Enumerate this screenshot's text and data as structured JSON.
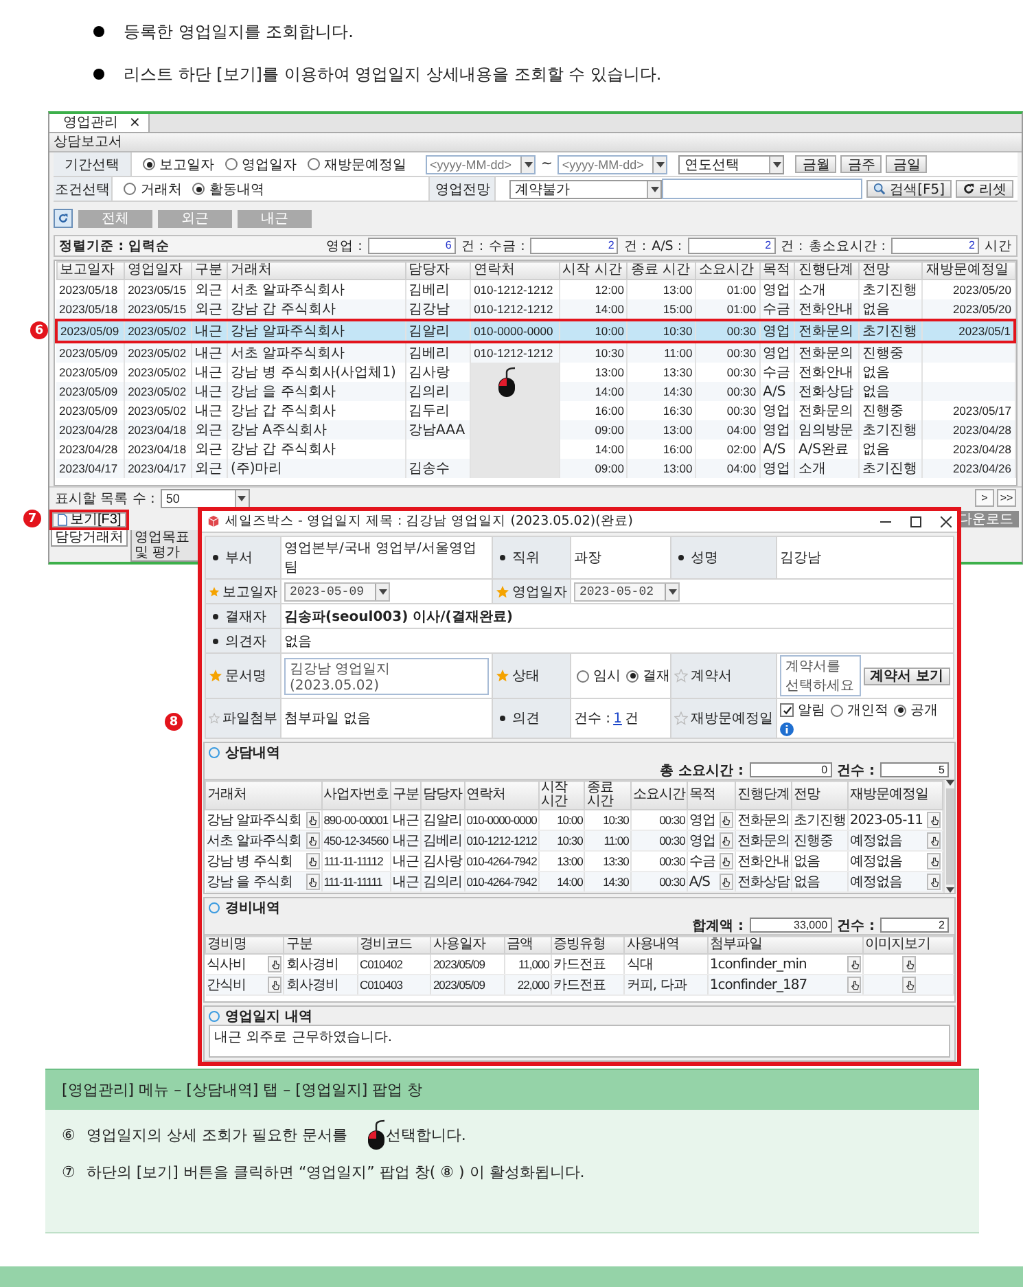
{
  "intro": [
    "등록한 영업일지를 조회합니다.",
    "리스트 하단 [보기]를 이용하여 영업일지 상세내용을 조회할 수 있습니다."
  ],
  "app": {
    "tabs": [
      {
        "label": "영업관리",
        "close": "×",
        "selected": true
      }
    ],
    "title": "상담보고서",
    "period": {
      "label": "기간선택",
      "options": [
        {
          "label": "보고일자",
          "selected": true
        },
        {
          "label": "영업일자",
          "selected": false
        },
        {
          "label": "재방문예정일",
          "selected": false
        }
      ],
      "from": {
        "placeholder": "<yyyy-MM-dd>"
      },
      "separator": "~",
      "to": {
        "placeholder": "<yyyy-MM-dd>"
      },
      "year": "연도선택",
      "quick": [
        "금월",
        "금주",
        "금일"
      ]
    },
    "condition": {
      "label": "조건선택",
      "options": [
        {
          "label": "거래처",
          "selected": false
        },
        {
          "label": "활동내역",
          "selected": true
        }
      ],
      "outlook_label": "영업전망",
      "outlook": "계약불가",
      "search_button": "검색[F5]",
      "reset_button": "리셋"
    },
    "filters": [
      "전체",
      "외근",
      "내근"
    ],
    "summary": {
      "sort": "정렬기준 : 입력순",
      "counts": [
        {
          "label": "영업 :",
          "value": "6",
          "unit": "건 :"
        },
        {
          "label": "수금 :",
          "value": "2",
          "unit": "건 :"
        },
        {
          "label": "A/S :",
          "value": "2",
          "unit": "건 :"
        },
        {
          "label": "총소요시간 :",
          "value": "2",
          "unit": "시간"
        }
      ]
    },
    "table": {
      "columns": [
        {
          "label": "보고일자",
          "kind": "code"
        },
        {
          "label": "영업일자",
          "kind": "code"
        },
        {
          "label": "구분",
          "kind": "text"
        },
        {
          "label": "거래처",
          "kind": "text"
        },
        {
          "label": "담당자",
          "kind": "text"
        },
        {
          "label": "연락처",
          "kind": "code"
        },
        {
          "label": "시작 시간",
          "kind": "num"
        },
        {
          "label": "종료 시간",
          "kind": "num"
        },
        {
          "label": "소요시간",
          "kind": "num"
        },
        {
          "label": "목적",
          "kind": "text"
        },
        {
          "label": "진행단계",
          "kind": "text"
        },
        {
          "label": "전망",
          "kind": "text"
        },
        {
          "label": "재방문예정일",
          "kind": "num"
        }
      ],
      "rows": [
        {
          "selected": false,
          "masked": false,
          "report_date": "2023/05/18",
          "work_date": "2023/05/15",
          "type": "외근",
          "client": "서초 알파주식회사",
          "staff": "김베리",
          "contact": "010-1212-1212",
          "start": "12:00",
          "end": "13:00",
          "duration": "01:00",
          "purpose": "영업",
          "stage": "소개",
          "outlook": "초기진행",
          "revisit": "2023/05/20"
        },
        {
          "selected": false,
          "masked": false,
          "report_date": "2023/05/18",
          "work_date": "2023/05/15",
          "type": "외근",
          "client": "강남 갑 주식회사",
          "staff": "김강남",
          "contact": "010-1212-1212",
          "start": "14:00",
          "end": "15:00",
          "duration": "01:00",
          "purpose": "수금",
          "stage": "전화안내",
          "outlook": "없음",
          "revisit": "2023/05/20"
        },
        {
          "selected": true,
          "masked": false,
          "callout": "6",
          "report_date": "2023/05/09",
          "work_date": "2023/05/02",
          "type": "내근",
          "client": "강남 알파주식회사",
          "staff": "김알리",
          "contact": "010-0000-0000",
          "start": "10:00",
          "end": "10:30",
          "duration": "00:30",
          "purpose": "영업",
          "stage": "전화문의",
          "outlook": "초기진행",
          "revisit": "2023/05/1"
        },
        {
          "selected": false,
          "masked": false,
          "report_date": "2023/05/09",
          "work_date": "2023/05/02",
          "type": "내근",
          "client": "서초 알파주식회사",
          "staff": "김베리",
          "contact": "010-1212-1212",
          "start": "10:30",
          "end": "11:00",
          "duration": "00:30",
          "purpose": "영업",
          "stage": "전화문의",
          "outlook": "진행중"
        },
        {
          "selected": false,
          "masked": true,
          "report_date": "2023/05/09",
          "work_date": "2023/05/02",
          "type": "내근",
          "client": "강남 병 주식회사(사업체1)",
          "staff": "김사랑",
          "start": "13:00",
          "end": "13:30",
          "duration": "00:30",
          "purpose": "수금",
          "stage": "전화안내",
          "outlook": "없음"
        },
        {
          "selected": false,
          "masked": true,
          "report_date": "2023/05/09",
          "work_date": "2023/05/02",
          "type": "내근",
          "client": "강남 을 주식회사",
          "staff": "김의리",
          "start": "14:00",
          "end": "14:30",
          "duration": "00:30",
          "purpose": "A/S",
          "stage": "전화상담",
          "outlook": "없음"
        },
        {
          "selected": false,
          "masked": true,
          "report_date": "2023/05/09",
          "work_date": "2023/05/02",
          "type": "내근",
          "client": "강남 갑 주식회사",
          "staff": "김두리",
          "start": "16:00",
          "end": "16:30",
          "duration": "00:30",
          "purpose": "영업",
          "stage": "전화문의",
          "outlook": "진행중",
          "revisit": "2023/05/17"
        },
        {
          "selected": false,
          "masked": true,
          "report_date": "2023/04/28",
          "work_date": "2023/04/18",
          "type": "외근",
          "client": "강남 A주식회사",
          "staff": "강남AAA",
          "start": "09:00",
          "end": "13:00",
          "duration": "04:00",
          "purpose": "영업",
          "stage": "임의방문",
          "outlook": "초기진행",
          "revisit": "2023/04/28"
        },
        {
          "selected": false,
          "masked": true,
          "report_date": "2023/04/28",
          "work_date": "2023/04/18",
          "type": "외근",
          "client": "강남 갑 주식회사",
          "start": "14:00",
          "end": "16:00",
          "duration": "02:00",
          "purpose": "A/S",
          "stage": "A/S완료",
          "outlook": "없음",
          "revisit": "2023/04/28"
        },
        {
          "selected": false,
          "masked": true,
          "report_date": "2023/04/17",
          "work_date": "2023/04/17",
          "type": "외근",
          "client": "(주)마리",
          "staff": "김송수",
          "start": "09:00",
          "end": "13:00",
          "duration": "04:00",
          "purpose": "영업",
          "stage": "소개",
          "outlook": "초기진행",
          "revisit": "2023/04/26"
        }
      ]
    },
    "footer": {
      "page_size_label": "표시할 목록 수 :",
      "page_size": "50",
      "pager": [
        ">",
        ">>"
      ],
      "view_button": "보기[F3]",
      "view_callout": "7",
      "download": "다운로드",
      "bottom_tabs": [
        {
          "label": "담당거래처",
          "selected": true
        },
        {
          "label": "영업목표 및 평가",
          "selected": false
        }
      ]
    }
  },
  "popup": {
    "title": "세일즈박스 - 영업일지 제목 : 김강남 영업일지 (2023.05.02)(완료)",
    "callout": "8",
    "form": {
      "dept": {
        "label": "부서",
        "kind": "dot",
        "value": "영업본부/국내 영업부/서울영업팀"
      },
      "position": {
        "label": "직위",
        "kind": "dot",
        "value": "과장"
      },
      "name": {
        "label": "성명",
        "kind": "dot",
        "value": "김강남"
      },
      "report_date": {
        "label": "보고일자",
        "kind": "star",
        "value": "2023-05-09"
      },
      "work_date": {
        "label": "영업일자",
        "kind": "star",
        "value": "2023-05-02"
      },
      "approver": {
        "label": "결재자",
        "kind": "dot",
        "value": "김송파(seoul003) 이사/(결재완료)"
      },
      "reviewer": {
        "label": "의견자",
        "kind": "dot",
        "value": "없음"
      },
      "doc_name": {
        "label": "문서명",
        "kind": "star",
        "value": "김강남 영업일지 (2023.05.02)"
      },
      "status": {
        "label": "상태",
        "kind": "star",
        "options": [
          {
            "label": "임시",
            "selected": false
          },
          {
            "label": "결재",
            "selected": true
          }
        ]
      },
      "contract": {
        "label": "계약서",
        "kind": "hollow",
        "placeholder": "계약서를 선택하세요",
        "button": "계약서 보기"
      },
      "attachment": {
        "label": "파일첨부",
        "kind": "hollow",
        "value": "첨부파일 없음"
      },
      "opinion": {
        "label": "의견",
        "kind": "dot",
        "prefix": "건수 :",
        "count": "1",
        "unit": "건"
      },
      "revisit": {
        "label": "재방문예정일",
        "kind": "hollow",
        "alarm": {
          "label": "알림",
          "checked": true
        },
        "options": [
          {
            "label": "개인적",
            "selected": false
          },
          {
            "label": "공개",
            "selected": true
          }
        ]
      }
    },
    "consult": {
      "title": "상담내역",
      "total_label": "총 소요시간 :",
      "total": "0",
      "count_label": "건수 :",
      "count": "5",
      "columns": [
        {
          "label": "거래처",
          "kind": "pick"
        },
        {
          "label": "사업자번호",
          "kind": "code"
        },
        {
          "label": "구분",
          "kind": "text"
        },
        {
          "label": "담당자",
          "kind": "text"
        },
        {
          "label": "연락처",
          "kind": "code"
        },
        {
          "label": "시작 시간",
          "kind": "num"
        },
        {
          "label": "종료 시간",
          "kind": "num"
        },
        {
          "label": "소요시간",
          "kind": "num"
        },
        {
          "label": "목적",
          "kind": "pick"
        },
        {
          "label": "진행단계",
          "kind": "text"
        },
        {
          "label": "전망",
          "kind": "text"
        },
        {
          "label": "재방문예정일",
          "kind": "pick"
        }
      ],
      "rows": [
        [
          "강남 알파주식회",
          "890-00-00001",
          "내근",
          "김알리",
          "010-0000-0000",
          "10:00",
          "10:30",
          "00:30",
          "영업",
          "전화문의",
          "초기진행",
          "2023-05-11"
        ],
        [
          "서초 알파주식회",
          "450-12-34560",
          "내근",
          "김베리",
          "010-1212-1212",
          "10:30",
          "11:00",
          "00:30",
          "영업",
          "전화문의",
          "진행중",
          "예정없음"
        ],
        [
          "강남 병 주식회",
          "111-11-11112",
          "내근",
          "김사랑",
          "010-4264-7942",
          "13:00",
          "13:30",
          "00:30",
          "수금",
          "전화안내",
          "없음",
          "예정없음"
        ],
        [
          "강남 을 주식회",
          "111-11-11111",
          "내근",
          "김의리",
          "010-4264-7942",
          "14:00",
          "14:30",
          "00:30",
          "A/S",
          "전화상담",
          "없음",
          "예정없음"
        ]
      ]
    },
    "expense": {
      "title": "경비내역",
      "total_label": "합계액 :",
      "total": "33,000",
      "count_label": "건수 :",
      "count": "2",
      "columns": [
        {
          "label": "경비명",
          "kind": "pick"
        },
        {
          "label": "구분",
          "kind": "text"
        },
        {
          "label": "경비코드",
          "kind": "code"
        },
        {
          "label": "사용일자",
          "kind": "code"
        },
        {
          "label": "금액",
          "kind": "num"
        },
        {
          "label": "증빙유형",
          "kind": "text"
        },
        {
          "label": "사용내역",
          "kind": "text"
        },
        {
          "label": "첨부파일",
          "kind": "pick"
        },
        {
          "label": "이미지보기",
          "kind": "icon"
        }
      ],
      "rows": [
        [
          "식사비",
          "회사경비",
          "C010402",
          "2023/05/09",
          "11,000",
          "카드전표",
          "식대",
          "1confinder_min"
        ],
        [
          "간식비",
          "회사경비",
          "C010403",
          "2023/05/09",
          "22,000",
          "카드전표",
          "커피, 다과",
          "1confinder_187"
        ]
      ]
    },
    "memo": {
      "title": "영업일지 내역",
      "value": "내근 외주로 근무하였습니다."
    }
  },
  "notes": {
    "header": "[영업관리] 메뉴 – [상담내역] 탭 – [영업일지] 팝업 창",
    "items": [
      {
        "marker": "⑥",
        "kind": "with-icon",
        "text": "영업일지의 상세 조회가 필요한 문서를",
        "after": "선택합니다."
      },
      {
        "marker": "⑦",
        "kind": "plain",
        "text": "하단의 [보기] 버튼을 클릭하면 “영업일지” 팝업 창( ⑧ ) 이 활성화됩니다."
      }
    ]
  }
}
